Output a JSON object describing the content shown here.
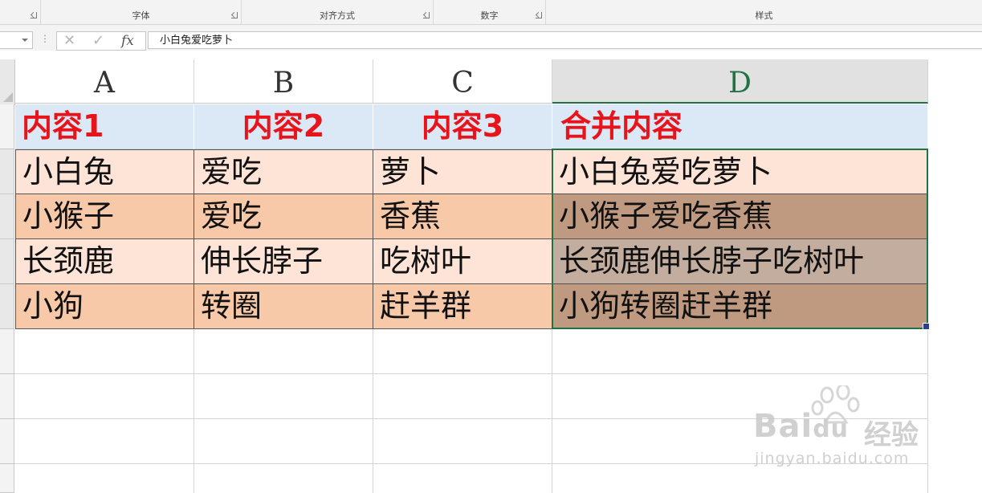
{
  "ribbon": {
    "groups": [
      {
        "label": "字体"
      },
      {
        "label": "对齐方式"
      },
      {
        "label": "数字"
      },
      {
        "label": "样式"
      }
    ]
  },
  "formula_bar": {
    "formula": "小白兔爱吃萝卜",
    "fx_label": "fx",
    "cancel_glyph": "✕",
    "enter_glyph": "✓"
  },
  "sheet": {
    "columns": [
      "A",
      "B",
      "C",
      "D"
    ],
    "selected_column": "D",
    "header_row": [
      "内容1",
      "内容2",
      "内容3",
      "合并内容"
    ],
    "rows": [
      [
        "小白兔",
        "爱吃",
        "萝卜",
        "小白兔爱吃萝卜"
      ],
      [
        "小猴子",
        "爱吃",
        "香蕉",
        "小猴子爱吃香蕉"
      ],
      [
        "长颈鹿",
        "伸长脖子",
        "吃树叶",
        "长颈鹿伸长脖子吃树叶"
      ],
      [
        "小狗",
        "转圈",
        "赶羊群",
        "小狗转圈赶羊群"
      ]
    ]
  },
  "colors": {
    "header_fill": "#dbe8f5",
    "header_text": "#e8141b",
    "row_light": "#fde4d6",
    "row_dark": "#f7c9a8",
    "merged_fills": [
      "#fde4d6",
      "#c09a80",
      "#c3ad9f",
      "#c09a80"
    ],
    "selection": "#217346"
  },
  "watermark": {
    "brand": "Bai",
    "brand2": "du",
    "cn": "经验",
    "url": "jingyan.baidu.com"
  }
}
